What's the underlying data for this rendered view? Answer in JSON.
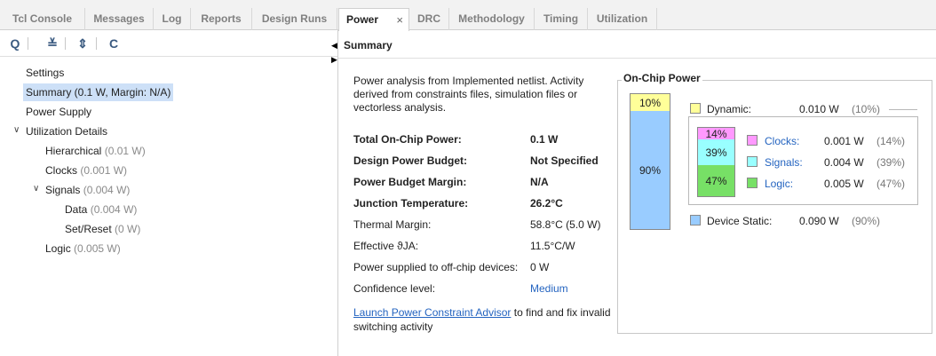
{
  "tabs": [
    {
      "label": "Tcl Console"
    },
    {
      "label": "Messages"
    },
    {
      "label": "Log"
    },
    {
      "label": "Reports"
    },
    {
      "label": "Design Runs"
    },
    {
      "label": "Power",
      "active": true,
      "close": "×"
    },
    {
      "label": "DRC"
    },
    {
      "label": "Methodology"
    },
    {
      "label": "Timing"
    },
    {
      "label": "Utilization"
    }
  ],
  "toolbar": {
    "icons": [
      "search-icon",
      "collapse-all-icon",
      "expand-all-icon",
      "refresh-icon"
    ],
    "glyphs": [
      "Q",
      "≚",
      "⇕",
      "C"
    ]
  },
  "tree": {
    "settings": "Settings",
    "summary": "Summary (0.1 W, Margin: N/A)",
    "power_supply": "Power Supply",
    "utilization_details": "Utilization Details",
    "hierarchical": {
      "label": "Hierarchical",
      "value": "(0.01 W)"
    },
    "clocks": {
      "label": "Clocks",
      "value": "(0.001 W)"
    },
    "signals": {
      "label": "Signals",
      "value": "(0.004 W)"
    },
    "data": {
      "label": "Data",
      "value": "(0.004 W)"
    },
    "set_reset": {
      "label": "Set/Reset",
      "value": "(0 W)"
    },
    "logic": {
      "label": "Logic",
      "value": "(0.005 W)"
    }
  },
  "summary": {
    "title": "Summary",
    "description": "Power analysis from Implemented netlist. Activity derived from constraints files, simulation files or vectorless analysis.",
    "rows": [
      {
        "label": "Total On-Chip Power:",
        "value": "0.1 W"
      },
      {
        "label": "Design Power Budget:",
        "value": "Not Specified"
      },
      {
        "label": "Power Budget Margin:",
        "value": "N/A"
      },
      {
        "label": "Junction Temperature:",
        "value": "26.2°C"
      },
      {
        "label": "Thermal Margin:",
        "value": "58.8°C (5.0 W)"
      },
      {
        "label": "Effective ϑJA:",
        "value": "11.5°C/W"
      },
      {
        "label": "Power supplied to off-chip devices:",
        "value": "0 W"
      },
      {
        "label": "Confidence level:",
        "value": "Medium"
      }
    ],
    "advisor_link": "Launch Power Constraint Advisor",
    "advisor_rest": " to find and fix invalid switching activity"
  },
  "on_chip_power": {
    "title": "On-Chip Power",
    "bar_dynamic": "10%",
    "bar_static": "90%",
    "dynamic": {
      "label": "Dynamic:",
      "value": "0.010 W",
      "pct": "(10%)",
      "color": "#ffff99"
    },
    "device_static": {
      "label": "Device Static:",
      "value": "0.090 W",
      "pct": "(90%)",
      "color": "#99ccff"
    },
    "breakdown": [
      {
        "label": "Clocks:",
        "value": "0.001 W",
        "pct": "(14%)",
        "bar": "14%",
        "color": "#ff99ff"
      },
      {
        "label": "Signals:",
        "value": "0.004 W",
        "pct": "(39%)",
        "bar": "39%",
        "color": "#99ffff"
      },
      {
        "label": "Logic:",
        "value": "0.005 W",
        "pct": "(47%)",
        "bar": "47%",
        "color": "#77e066"
      }
    ]
  }
}
